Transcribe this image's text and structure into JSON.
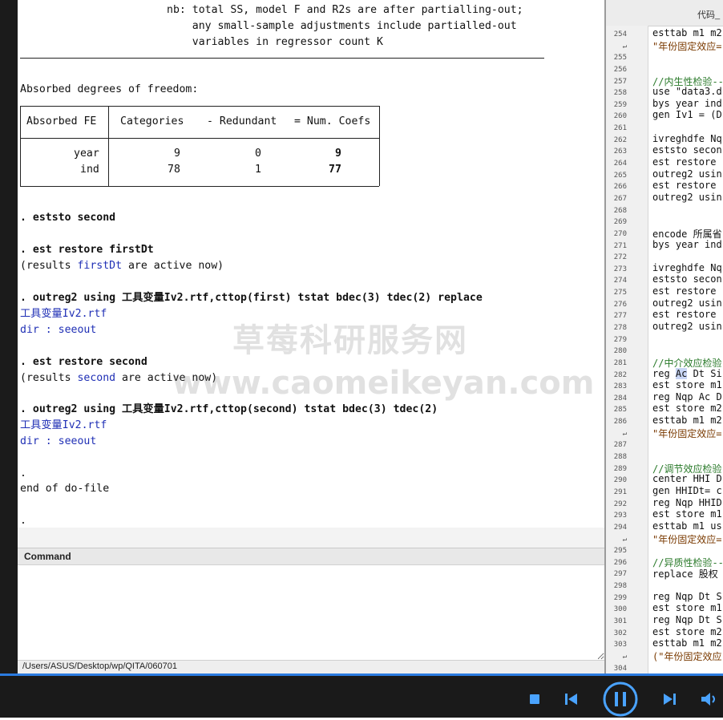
{
  "results": {
    "nb_lines": [
      "nb: total SS, model F and R2s are after partialling-out;",
      "    any small-sample adjustments include partialled-out",
      "    variables in regressor count K"
    ],
    "absorbed_title": "Absorbed degrees of freedom:",
    "absorbed_table": {
      "headers": [
        "Absorbed FE",
        "Categories",
        "- Redundant",
        "= Num. Coefs"
      ],
      "rows": [
        {
          "fe": "year",
          "categories": "9",
          "redundant": "0",
          "coefs": "9"
        },
        {
          "fe": "ind",
          "categories": "78",
          "redundant": "1",
          "coefs": "77"
        }
      ]
    },
    "log": {
      "cmd_eststo": ". eststo second",
      "cmd_est_restore_first": ". est restore firstDt",
      "msg_results_first_pre": "(results ",
      "msg_results_first_link": "firstDt",
      "msg_results_first_post": " are active now)",
      "cmd_outreg_first": ". outreg2 using 工具变量Iv2.rtf,cttop(first) tstat bdec(3) tdec(2) replace",
      "file_link_1": "工具变量Iv2.rtf",
      "dir_label_1": "dir : ",
      "seeout_1": "seeout",
      "cmd_est_restore_second": ". est restore second",
      "msg_results_second_pre": "(results ",
      "msg_results_second_link": "second",
      "msg_results_second_post": " are active now)",
      "cmd_outreg_second": ". outreg2 using 工具变量Iv2.rtf,cttop(second) tstat bdec(3) tdec(2)",
      "file_link_2": "工具变量Iv2.rtf",
      "dir_label_2": "dir : ",
      "seeout_2": "seeout",
      "dot_1": ".",
      "end_do": "end of do-file",
      "dot_2": "."
    }
  },
  "command": {
    "title": "Command",
    "input_value": ""
  },
  "status_bar": {
    "path": "/Users/ASUS/Desktop/wp/QITA/060701"
  },
  "editor": {
    "tab_title": "代码_",
    "lines": [
      {
        "n": "254",
        "t": "esttab m1 m2",
        "k": "code"
      },
      {
        "n": "↵",
        "t": "\"年份固定效应=",
        "k": "str"
      },
      {
        "n": "255",
        "t": "",
        "k": "code"
      },
      {
        "n": "256",
        "t": "",
        "k": "code"
      },
      {
        "n": "257",
        "t": "//内生性检验--",
        "k": "comment"
      },
      {
        "n": "258",
        "t": "use \"data3.d",
        "k": "code"
      },
      {
        "n": "259",
        "t": "bys year ind",
        "k": "code"
      },
      {
        "n": "260",
        "t": "gen Iv1 = (D",
        "k": "code"
      },
      {
        "n": "261",
        "t": "",
        "k": "code"
      },
      {
        "n": "262",
        "t": "ivreghdfe Nq",
        "k": "code"
      },
      {
        "n": "263",
        "t": "eststo secon",
        "k": "code"
      },
      {
        "n": "264",
        "t": "est restore",
        "k": "code"
      },
      {
        "n": "265",
        "t": "outreg2 usin",
        "k": "code"
      },
      {
        "n": "266",
        "t": "est restore",
        "k": "code"
      },
      {
        "n": "267",
        "t": "outreg2 usin",
        "k": "code"
      },
      {
        "n": "268",
        "t": "",
        "k": "code"
      },
      {
        "n": "269",
        "t": "",
        "k": "code"
      },
      {
        "n": "270",
        "t": "encode 所属省",
        "k": "code"
      },
      {
        "n": "271",
        "t": "bys year ind",
        "k": "code"
      },
      {
        "n": "272",
        "t": "",
        "k": "code"
      },
      {
        "n": "273",
        "t": "ivreghdfe Nq",
        "k": "code"
      },
      {
        "n": "274",
        "t": "eststo secon",
        "k": "code"
      },
      {
        "n": "275",
        "t": "est restore",
        "k": "code"
      },
      {
        "n": "276",
        "t": "outreg2 usin",
        "k": "code"
      },
      {
        "n": "277",
        "t": "est restore",
        "k": "code"
      },
      {
        "n": "278",
        "t": "outreg2 usin",
        "k": "code"
      },
      {
        "n": "279",
        "t": "",
        "k": "code"
      },
      {
        "n": "280",
        "t": "",
        "k": "code"
      },
      {
        "n": "281",
        "t": "//中介效应检验",
        "k": "comment"
      },
      {
        "n": "282",
        "t": "reg Ac Dt Si",
        "k": "code"
      },
      {
        "n": "283",
        "t": "est store m1",
        "k": "code"
      },
      {
        "n": "284",
        "t": "reg Nqp Ac D",
        "k": "code"
      },
      {
        "n": "285",
        "t": "est store m2",
        "k": "code"
      },
      {
        "n": "286",
        "t": "esttab m1 m2",
        "k": "code"
      },
      {
        "n": "↵",
        "t": "\"年份固定效应=",
        "k": "str"
      },
      {
        "n": "287",
        "t": "",
        "k": "code"
      },
      {
        "n": "288",
        "t": "",
        "k": "code"
      },
      {
        "n": "289",
        "t": "//调节效应检验",
        "k": "comment"
      },
      {
        "n": "290",
        "t": "center HHI D",
        "k": "code"
      },
      {
        "n": "291",
        "t": "gen HHIDt= c",
        "k": "code"
      },
      {
        "n": "292",
        "t": "reg Nqp HHID",
        "k": "code"
      },
      {
        "n": "293",
        "t": "est store m1",
        "k": "code"
      },
      {
        "n": "294",
        "t": "esttab m1 us",
        "k": "code"
      },
      {
        "n": "↵",
        "t": "\"年份固定效应=",
        "k": "str"
      },
      {
        "n": "295",
        "t": "",
        "k": "code"
      },
      {
        "n": "296",
        "t": "//异质性检验--",
        "k": "comment"
      },
      {
        "n": "297",
        "t": "replace 股权",
        "k": "code"
      },
      {
        "n": "298",
        "t": "",
        "k": "code"
      },
      {
        "n": "299",
        "t": "reg Nqp Dt S",
        "k": "code"
      },
      {
        "n": "300",
        "t": "est store m1",
        "k": "code"
      },
      {
        "n": "301",
        "t": "reg Nqp Dt S",
        "k": "code"
      },
      {
        "n": "302",
        "t": "est store m2",
        "k": "code"
      },
      {
        "n": "303",
        "t": "esttab m1 m2",
        "k": "code"
      },
      {
        "n": "↵",
        "t": "(\"年份固定效应",
        "k": "str"
      },
      {
        "n": "304",
        "t": "",
        "k": "code"
      }
    ]
  },
  "watermark": {
    "cn": "草莓科研服务网",
    "url": "www.caomeikeyan.com"
  },
  "player": {
    "progress_fraction": 1.0,
    "accent_color": "#2b7be0",
    "icons": [
      "stop-icon",
      "previous-icon",
      "pause-icon",
      "next-icon",
      "volume-icon"
    ]
  }
}
